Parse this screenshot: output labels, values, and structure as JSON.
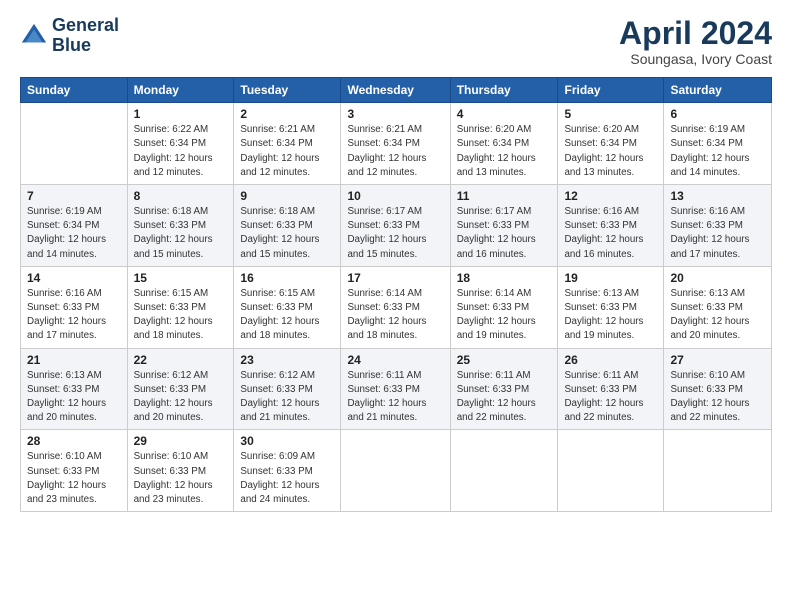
{
  "logo": {
    "line1": "General",
    "line2": "Blue"
  },
  "title": "April 2024",
  "subtitle": "Soungasa, Ivory Coast",
  "header_days": [
    "Sunday",
    "Monday",
    "Tuesday",
    "Wednesday",
    "Thursday",
    "Friday",
    "Saturday"
  ],
  "weeks": [
    [
      {
        "num": "",
        "info": ""
      },
      {
        "num": "1",
        "info": "Sunrise: 6:22 AM\nSunset: 6:34 PM\nDaylight: 12 hours\nand 12 minutes."
      },
      {
        "num": "2",
        "info": "Sunrise: 6:21 AM\nSunset: 6:34 PM\nDaylight: 12 hours\nand 12 minutes."
      },
      {
        "num": "3",
        "info": "Sunrise: 6:21 AM\nSunset: 6:34 PM\nDaylight: 12 hours\nand 12 minutes."
      },
      {
        "num": "4",
        "info": "Sunrise: 6:20 AM\nSunset: 6:34 PM\nDaylight: 12 hours\nand 13 minutes."
      },
      {
        "num": "5",
        "info": "Sunrise: 6:20 AM\nSunset: 6:34 PM\nDaylight: 12 hours\nand 13 minutes."
      },
      {
        "num": "6",
        "info": "Sunrise: 6:19 AM\nSunset: 6:34 PM\nDaylight: 12 hours\nand 14 minutes."
      }
    ],
    [
      {
        "num": "7",
        "info": "Sunrise: 6:19 AM\nSunset: 6:34 PM\nDaylight: 12 hours\nand 14 minutes."
      },
      {
        "num": "8",
        "info": "Sunrise: 6:18 AM\nSunset: 6:33 PM\nDaylight: 12 hours\nand 15 minutes."
      },
      {
        "num": "9",
        "info": "Sunrise: 6:18 AM\nSunset: 6:33 PM\nDaylight: 12 hours\nand 15 minutes."
      },
      {
        "num": "10",
        "info": "Sunrise: 6:17 AM\nSunset: 6:33 PM\nDaylight: 12 hours\nand 15 minutes."
      },
      {
        "num": "11",
        "info": "Sunrise: 6:17 AM\nSunset: 6:33 PM\nDaylight: 12 hours\nand 16 minutes."
      },
      {
        "num": "12",
        "info": "Sunrise: 6:16 AM\nSunset: 6:33 PM\nDaylight: 12 hours\nand 16 minutes."
      },
      {
        "num": "13",
        "info": "Sunrise: 6:16 AM\nSunset: 6:33 PM\nDaylight: 12 hours\nand 17 minutes."
      }
    ],
    [
      {
        "num": "14",
        "info": "Sunrise: 6:16 AM\nSunset: 6:33 PM\nDaylight: 12 hours\nand 17 minutes."
      },
      {
        "num": "15",
        "info": "Sunrise: 6:15 AM\nSunset: 6:33 PM\nDaylight: 12 hours\nand 18 minutes."
      },
      {
        "num": "16",
        "info": "Sunrise: 6:15 AM\nSunset: 6:33 PM\nDaylight: 12 hours\nand 18 minutes."
      },
      {
        "num": "17",
        "info": "Sunrise: 6:14 AM\nSunset: 6:33 PM\nDaylight: 12 hours\nand 18 minutes."
      },
      {
        "num": "18",
        "info": "Sunrise: 6:14 AM\nSunset: 6:33 PM\nDaylight: 12 hours\nand 19 minutes."
      },
      {
        "num": "19",
        "info": "Sunrise: 6:13 AM\nSunset: 6:33 PM\nDaylight: 12 hours\nand 19 minutes."
      },
      {
        "num": "20",
        "info": "Sunrise: 6:13 AM\nSunset: 6:33 PM\nDaylight: 12 hours\nand 20 minutes."
      }
    ],
    [
      {
        "num": "21",
        "info": "Sunrise: 6:13 AM\nSunset: 6:33 PM\nDaylight: 12 hours\nand 20 minutes."
      },
      {
        "num": "22",
        "info": "Sunrise: 6:12 AM\nSunset: 6:33 PM\nDaylight: 12 hours\nand 20 minutes."
      },
      {
        "num": "23",
        "info": "Sunrise: 6:12 AM\nSunset: 6:33 PM\nDaylight: 12 hours\nand 21 minutes."
      },
      {
        "num": "24",
        "info": "Sunrise: 6:11 AM\nSunset: 6:33 PM\nDaylight: 12 hours\nand 21 minutes."
      },
      {
        "num": "25",
        "info": "Sunrise: 6:11 AM\nSunset: 6:33 PM\nDaylight: 12 hours\nand 22 minutes."
      },
      {
        "num": "26",
        "info": "Sunrise: 6:11 AM\nSunset: 6:33 PM\nDaylight: 12 hours\nand 22 minutes."
      },
      {
        "num": "27",
        "info": "Sunrise: 6:10 AM\nSunset: 6:33 PM\nDaylight: 12 hours\nand 22 minutes."
      }
    ],
    [
      {
        "num": "28",
        "info": "Sunrise: 6:10 AM\nSunset: 6:33 PM\nDaylight: 12 hours\nand 23 minutes."
      },
      {
        "num": "29",
        "info": "Sunrise: 6:10 AM\nSunset: 6:33 PM\nDaylight: 12 hours\nand 23 minutes."
      },
      {
        "num": "30",
        "info": "Sunrise: 6:09 AM\nSunset: 6:33 PM\nDaylight: 12 hours\nand 24 minutes."
      },
      {
        "num": "",
        "info": ""
      },
      {
        "num": "",
        "info": ""
      },
      {
        "num": "",
        "info": ""
      },
      {
        "num": "",
        "info": ""
      }
    ]
  ]
}
